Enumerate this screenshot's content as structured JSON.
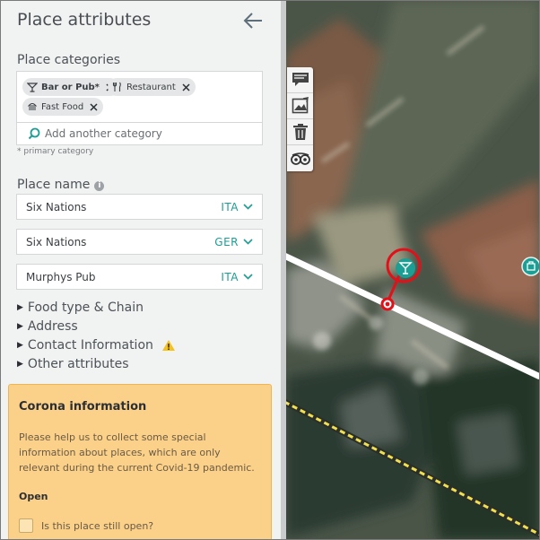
{
  "sidebar": {
    "title": "Place attributes",
    "categories_label": "Place categories",
    "chips": [
      {
        "label": "Bar or Pub*",
        "primary": true
      },
      {
        "label": "Restaurant",
        "primary": false
      },
      {
        "label": "Fast Food",
        "primary": false
      }
    ],
    "add_category_placeholder": "Add another category",
    "primary_hint": "* primary category",
    "place_name_label": "Place name",
    "names": [
      {
        "value": "Six Nations",
        "lang": "ITA"
      },
      {
        "value": "Six Nations",
        "lang": "GER"
      },
      {
        "value": "Murphys Pub",
        "lang": "ITA"
      }
    ],
    "sections": [
      "Food type & Chain",
      "Address",
      "Contact Information",
      "Other attributes"
    ],
    "corona": {
      "title": "Corona information",
      "text": "Please help us to collect some special information about places, which are only relevant during the current Covid-19 pandemic.",
      "open_label": "Open",
      "check_label": "Is this place still open?"
    }
  },
  "colors": {
    "accent": "#1b9e93",
    "marker_ring": "#e3101a",
    "warning": "#f5c21b",
    "corona_bg": "#fbd18a"
  },
  "icons": {
    "back": "arrow-left-icon",
    "search": "search-icon",
    "tools": [
      "chat-bubble-icon",
      "image-edit-icon",
      "trash-icon",
      "tripadvisor-icon"
    ]
  }
}
